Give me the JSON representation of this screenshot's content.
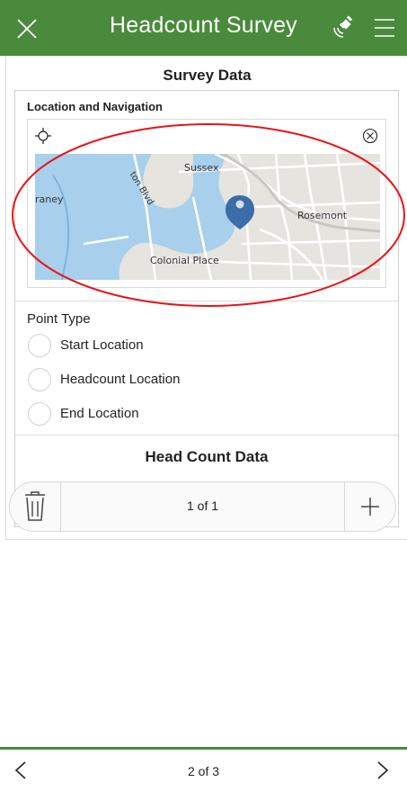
{
  "header": {
    "title": "Headcount Survey",
    "close_icon": "close-icon",
    "gps_icon": "gps-satellite-icon",
    "menu_icon": "menu-icon",
    "background_color": "#4a8a3c"
  },
  "survey": {
    "section_title": "Survey Data",
    "location_group_label": "Location and Navigation",
    "map": {
      "labels": [
        "Sussex",
        "Rosemont",
        "Colonial Place",
        "raney",
        "ton Blvd"
      ]
    },
    "point_type": {
      "label": "Point Type",
      "options": [
        "Start Location",
        "Headcount Location",
        "End Location"
      ]
    },
    "headcount_section_title": "Head Count Data"
  },
  "pager": {
    "count": "1 of 1",
    "trash_icon": "trash-icon",
    "add_icon": "plus-icon"
  },
  "footer": {
    "page": "2 of 3",
    "prev_icon": "chevron-left-icon",
    "next_icon": "chevron-right-icon"
  },
  "annotation": {
    "color": "#e8141a"
  }
}
